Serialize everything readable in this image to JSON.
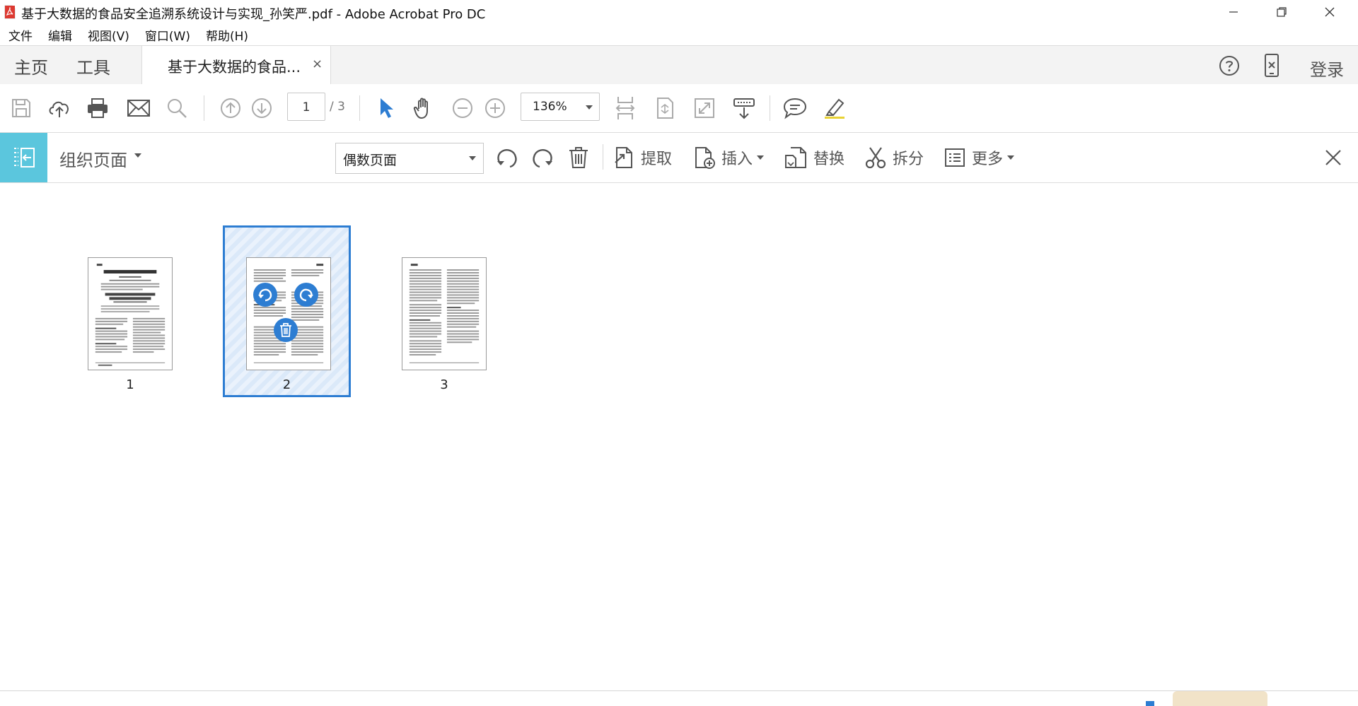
{
  "window": {
    "title": "基于大数据的食品安全追溯系统设计与实现_孙笑严.pdf - Adobe Acrobat Pro DC"
  },
  "menu": [
    "文件",
    "编辑",
    "视图(V)",
    "窗口(W)",
    "帮助(H)"
  ],
  "tabs": {
    "home": "主页",
    "tools": "工具",
    "document": "基于大数据的食品...",
    "close": "×",
    "login": "登录"
  },
  "toolbar": {
    "page_current": "1",
    "page_total": "/ 3",
    "zoom": "136%"
  },
  "organize": {
    "title": "组织页面",
    "filter": "偶数页面",
    "extract": "提取",
    "insert": "插入",
    "replace": "替换",
    "split": "拆分",
    "more": "更多"
  },
  "pages": [
    {
      "number": "1",
      "selected": false
    },
    {
      "number": "2",
      "selected": true
    },
    {
      "number": "3",
      "selected": false
    }
  ],
  "colors": {
    "accent": "#2d7dd2",
    "organize_icon_bg": "#5bc6dd",
    "pdf_red": "#d9251c"
  }
}
